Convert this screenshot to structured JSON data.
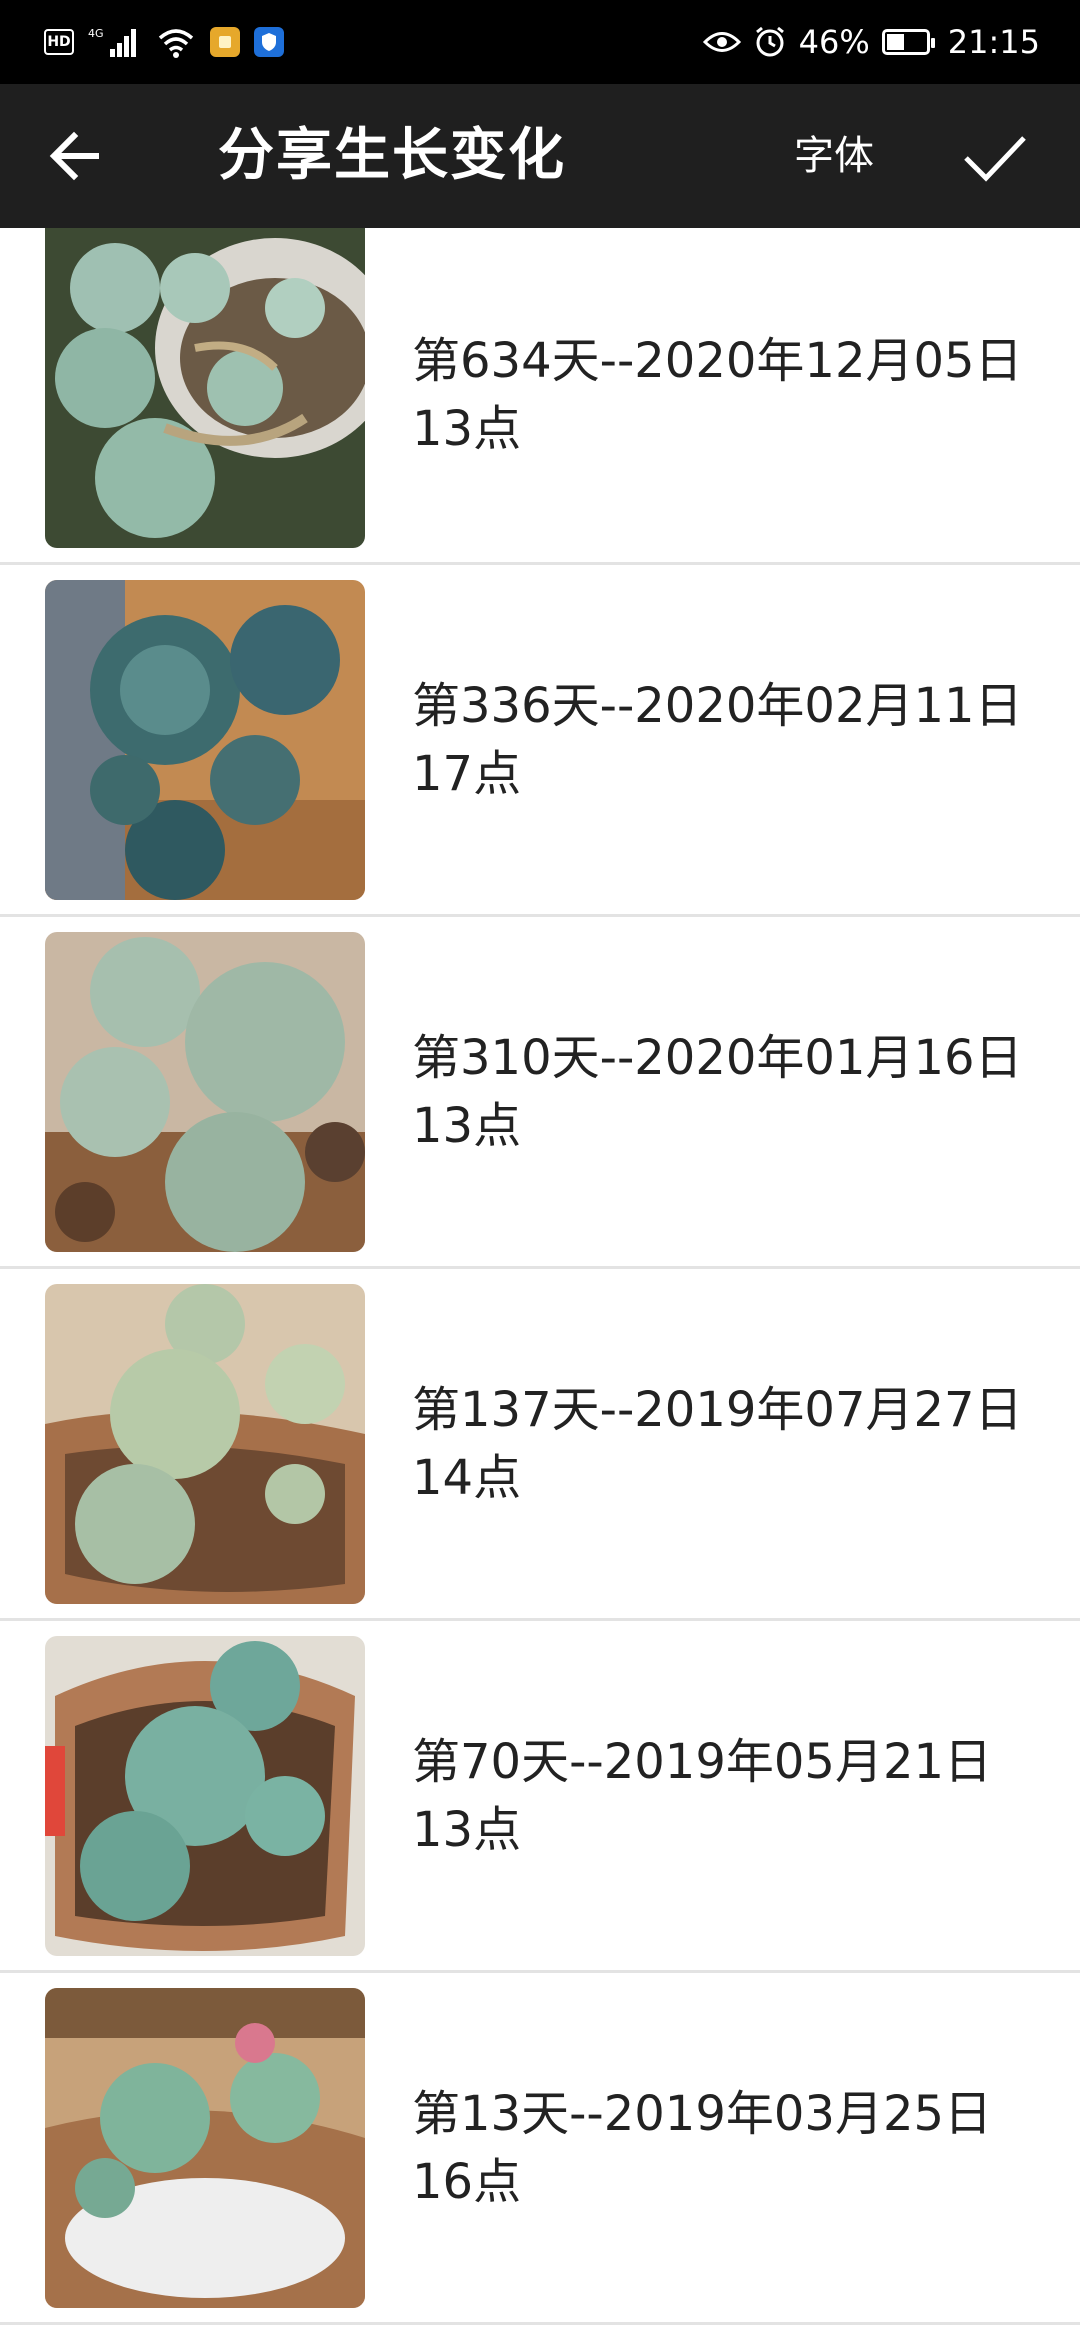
{
  "status_bar": {
    "hd_label": "HD",
    "network_label": "4G",
    "battery_percent": "46%",
    "battery_level": 0.46,
    "time": "21:15"
  },
  "toolbar": {
    "title": "分享生长变化",
    "font_label": "字体",
    "back_icon": "arrow-left-icon",
    "confirm_icon": "checkmark-icon"
  },
  "entries": [
    {
      "line1": "第634天--2020年12月05日",
      "line2": "13点"
    },
    {
      "line1": "第336天--2020年02月11日",
      "line2": "17点"
    },
    {
      "line1": "第310天--2020年01月16日",
      "line2": "13点"
    },
    {
      "line1": "第137天--2019年07月27日",
      "line2": "14点"
    },
    {
      "line1": "第70天--2019年05月21日",
      "line2": "13点"
    },
    {
      "line1": "第13天--2019年03月25日",
      "line2": "16点"
    }
  ],
  "colors": {
    "toolbar_bg": "#1f1f1f",
    "status_bg": "#000000",
    "divider": "#e3e3e3",
    "text": "#222222"
  }
}
